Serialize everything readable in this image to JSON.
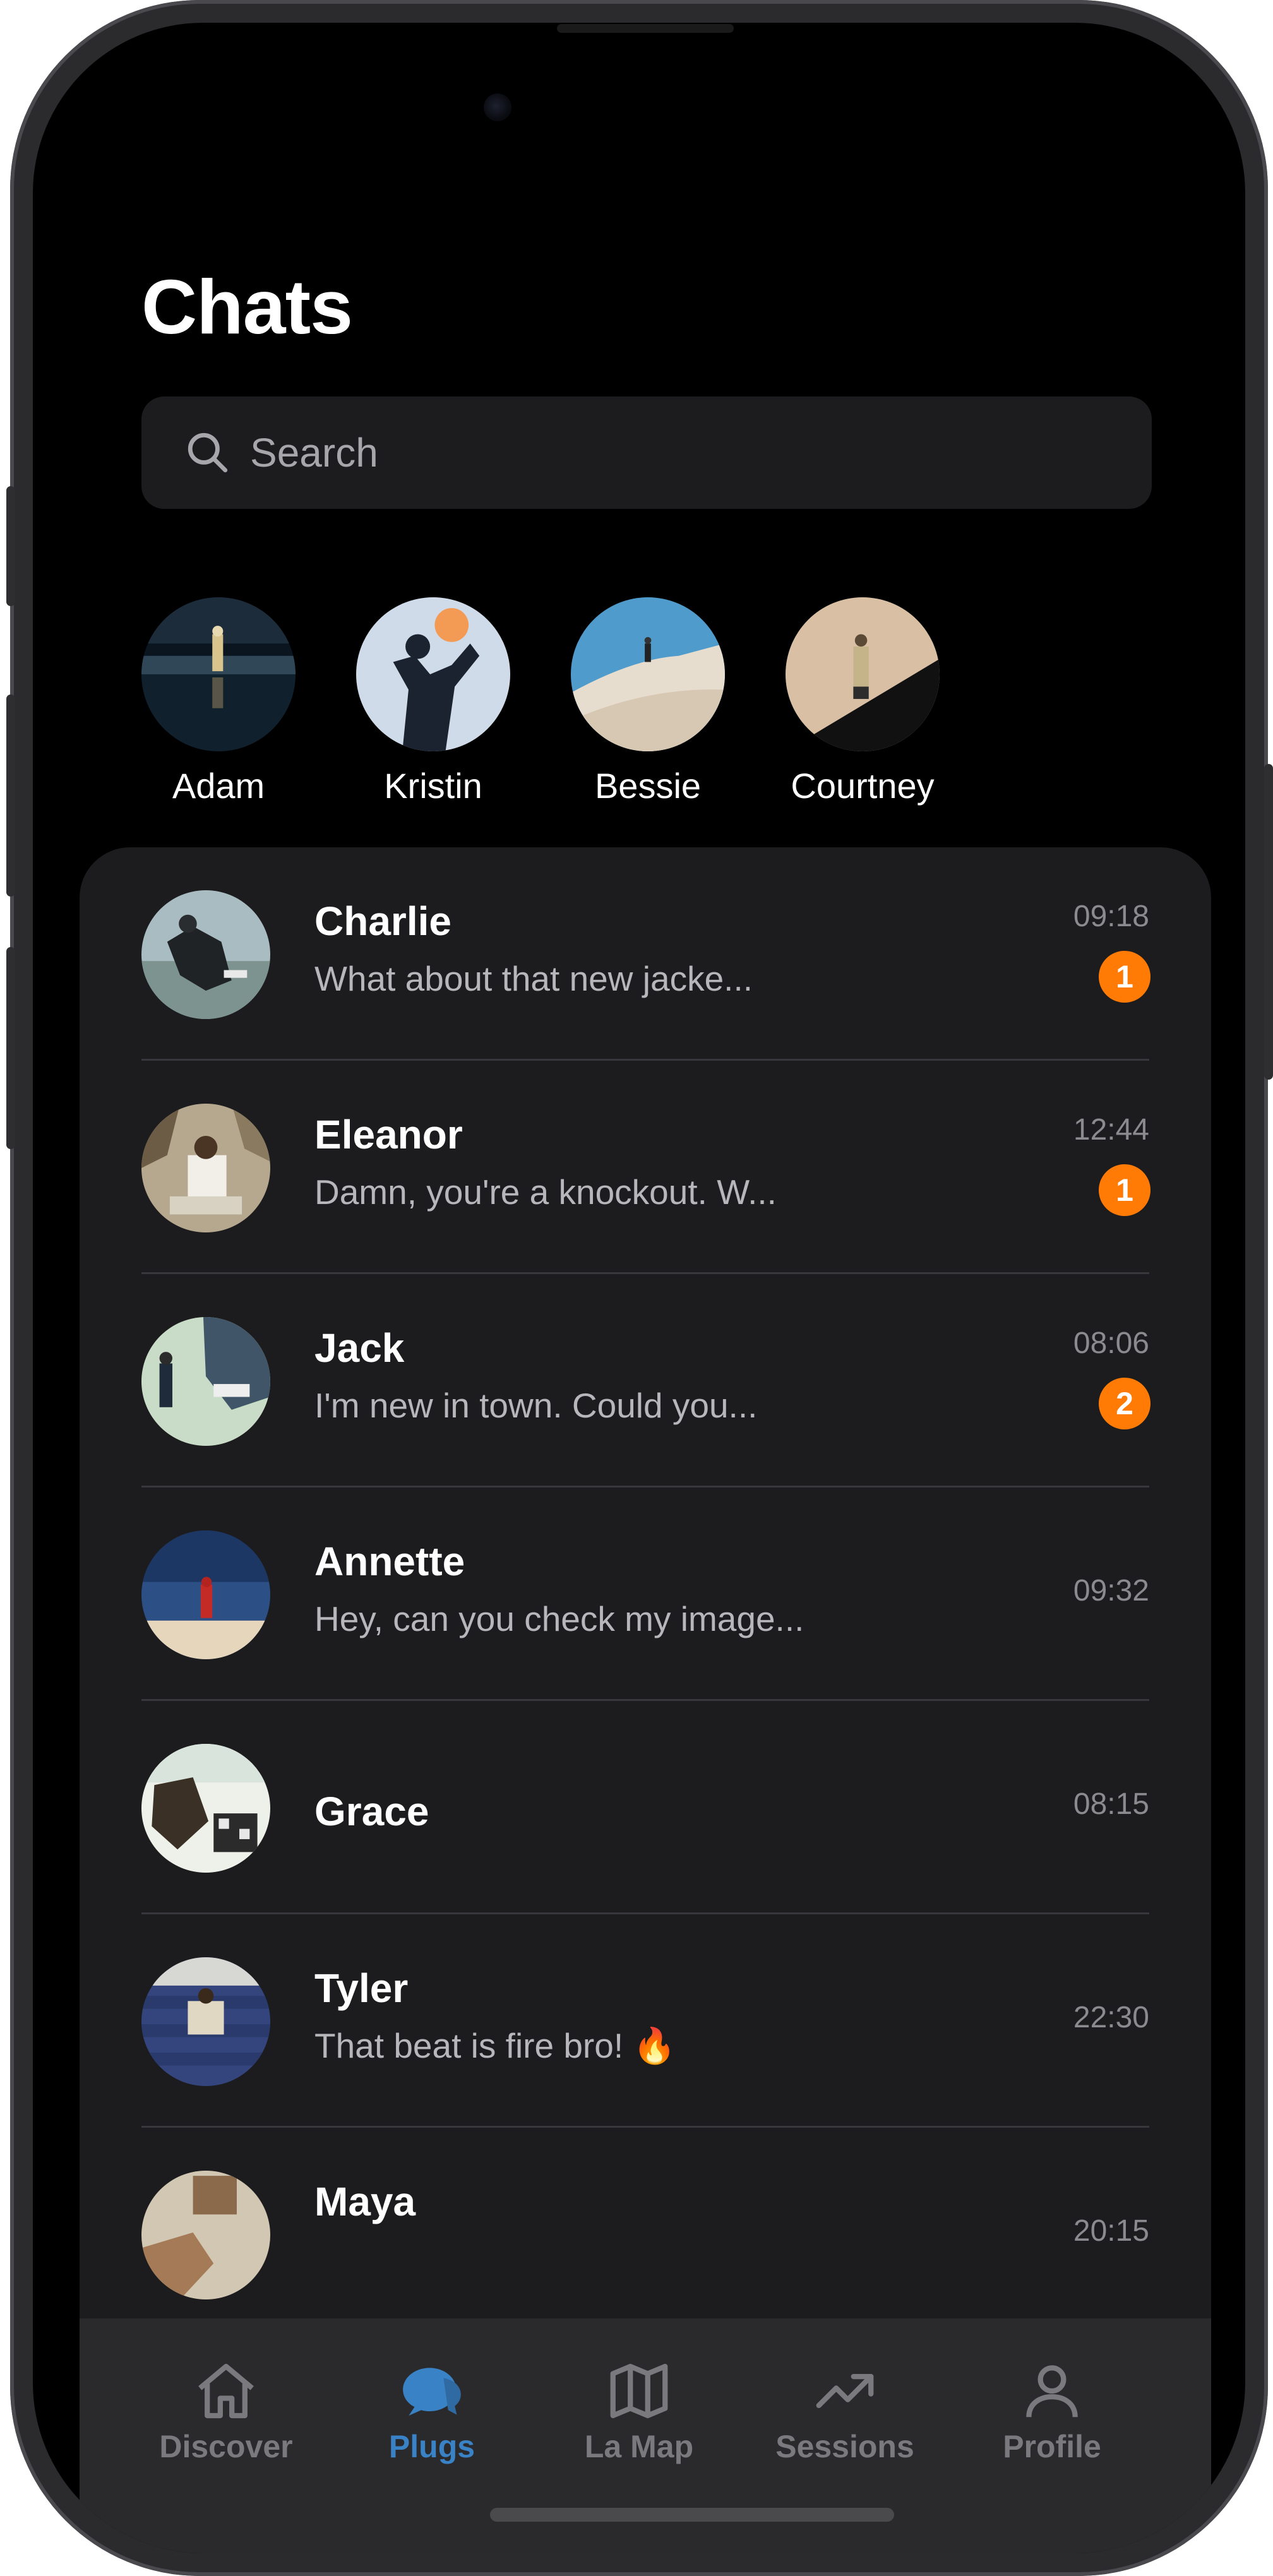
{
  "header": {
    "title": "Chats"
  },
  "search": {
    "placeholder": "Search"
  },
  "stories": [
    {
      "name": "Adam"
    },
    {
      "name": "Kristin"
    },
    {
      "name": "Bessie"
    },
    {
      "name": "Courtney"
    }
  ],
  "chats": [
    {
      "name": "Charlie",
      "message": "What about that new jacke...",
      "time": "09:18",
      "unread": "1"
    },
    {
      "name": "Eleanor",
      "message": "Damn, you're a knockout. W...",
      "time": "12:44",
      "unread": "1"
    },
    {
      "name": "Jack",
      "message": "I'm new in town. Could you...",
      "time": "08:06",
      "unread": "2"
    },
    {
      "name": "Annette",
      "message": "Hey, can you check my image...",
      "time": "09:32",
      "unread": ""
    },
    {
      "name": "Grace",
      "message": "",
      "time": "08:15",
      "unread": ""
    },
    {
      "name": "Tyler",
      "message": "That beat is fire bro! 🔥",
      "time": "22:30",
      "unread": ""
    },
    {
      "name": "Maya",
      "message": "",
      "time": "20:15",
      "unread": ""
    }
  ],
  "tabbar": {
    "tabs": [
      {
        "label": "Discover",
        "icon": "home-icon",
        "active": false
      },
      {
        "label": "Plugs",
        "icon": "chat-bubbles-icon",
        "active": true
      },
      {
        "label": "La Map",
        "icon": "map-icon",
        "active": false
      },
      {
        "label": "Sessions",
        "icon": "trending-up-icon",
        "active": false
      },
      {
        "label": "Profile",
        "icon": "person-icon",
        "active": false
      }
    ]
  },
  "colors": {
    "accent": "#3a82c6",
    "badge": "#ff7b06",
    "background": "#000000",
    "panel": "#1c1c1e"
  }
}
